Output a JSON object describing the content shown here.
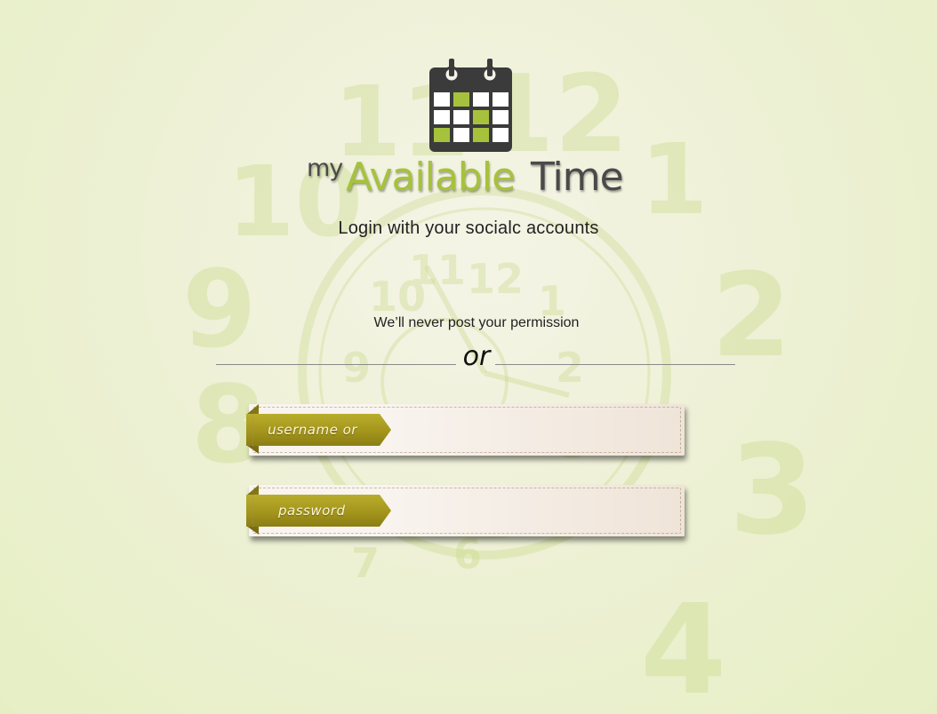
{
  "logo": {
    "prefix": "my",
    "highlight": "Available",
    "suffix": "Time",
    "accent_color": "#a6c23c",
    "dark_color": "#4a4a4a"
  },
  "social": {
    "title": "Login with your socialc accounts",
    "note": "We’ll never post your permission"
  },
  "divider": {
    "label": "or"
  },
  "form": {
    "username_label": "username or email",
    "password_label": "password",
    "ribbon_color": "#a4951c"
  },
  "background": {
    "clock_numbers": [
      "11",
      "12",
      "1",
      "2",
      "3",
      "4",
      "10",
      "9",
      "8"
    ]
  }
}
